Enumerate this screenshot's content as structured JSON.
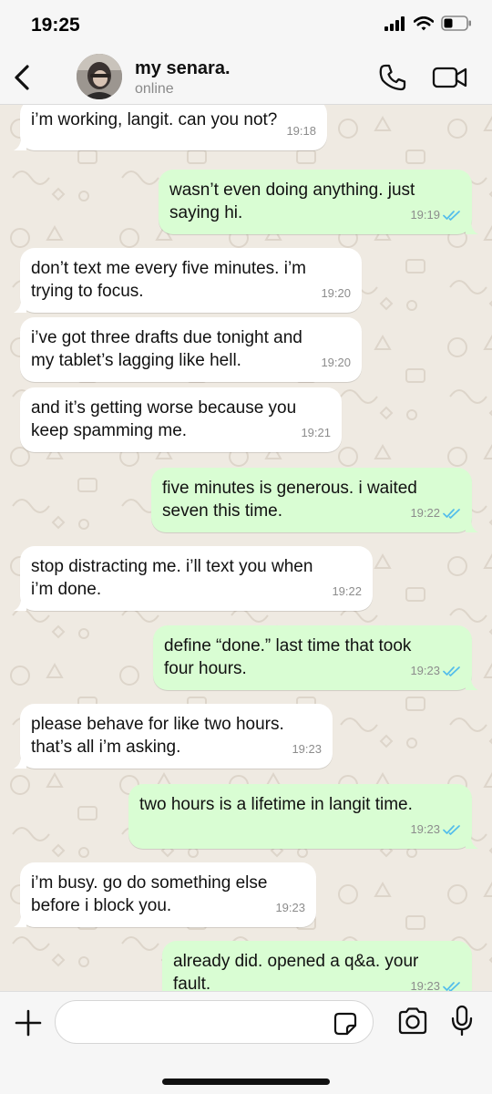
{
  "status_bar": {
    "time": "19:25",
    "icons": [
      "signal-icon",
      "wifi-icon",
      "battery-icon"
    ]
  },
  "header": {
    "back_icon": "chevron-left-icon",
    "contact_name": "my senara.",
    "contact_status": "online",
    "call_icon": "phone-icon",
    "video_icon": "video-camera-icon"
  },
  "colors": {
    "incoming_bubble": "#ffffff",
    "outgoing_bubble": "#d9fdd3",
    "read_ticks": "#53bdeb",
    "chat_background": "#efeae2"
  },
  "messages": [
    {
      "direction": "in",
      "text": "i’m working, langit. can you not?",
      "time": "19:18"
    },
    {
      "direction": "out",
      "text": "wasn’t even doing anything. just\nsaying hi.",
      "time": "19:19",
      "status": "read"
    },
    {
      "direction": "in",
      "text": "don’t text me every five minutes. i’m\ntrying to focus.",
      "time": "19:20"
    },
    {
      "direction": "in",
      "text": "i’ve got three drafts due tonight and\nmy tablet’s lagging like hell.",
      "time": "19:20"
    },
    {
      "direction": "in",
      "text": "and it’s getting worse because you\nkeep spamming me.",
      "time": "19:21"
    },
    {
      "direction": "out",
      "text": "five minutes is generous. i waited\nseven this time.",
      "time": "19:22",
      "status": "read"
    },
    {
      "direction": "in",
      "text": "stop distracting me. i’ll text you when\ni’m done.",
      "time": "19:22"
    },
    {
      "direction": "out",
      "text": "define “done.” last time that took\nfour hours.",
      "time": "19:23",
      "status": "read"
    },
    {
      "direction": "in",
      "text": "please behave for like two hours.\nthat’s all i’m asking.",
      "time": "19:23"
    },
    {
      "direction": "out",
      "text": "two hours is a lifetime in langit time.",
      "time": "19:23",
      "status": "read"
    },
    {
      "direction": "in",
      "text": "i’m busy. go do something else\nbefore i block you.",
      "time": "19:23"
    },
    {
      "direction": "out",
      "text": "already did. opened a q&a. your\nfault.",
      "time": "19:23",
      "status": "read"
    }
  ],
  "input_bar": {
    "plus_icon": "plus-icon",
    "placeholder": "",
    "value": "",
    "sticker_icon": "sticker-icon",
    "camera_icon": "camera-icon",
    "mic_icon": "microphone-icon"
  }
}
